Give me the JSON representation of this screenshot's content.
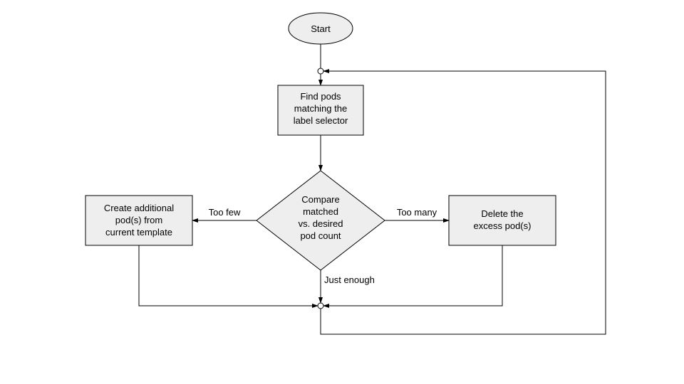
{
  "nodes": {
    "start": "Start",
    "find_l1": "Find pods",
    "find_l2": "matching the",
    "find_l3": "label selector",
    "cmp_l1": "Compare",
    "cmp_l2": "matched",
    "cmp_l3": "vs. desired",
    "cmp_l4": "pod count",
    "create_l1": "Create additional",
    "create_l2": "pod(s) from",
    "create_l3": "current template",
    "delete_l1": "Delete the",
    "delete_l2": "excess pod(s)"
  },
  "edges": {
    "too_few": "Too few",
    "too_many": "Too many",
    "just_enough": "Just enough"
  }
}
